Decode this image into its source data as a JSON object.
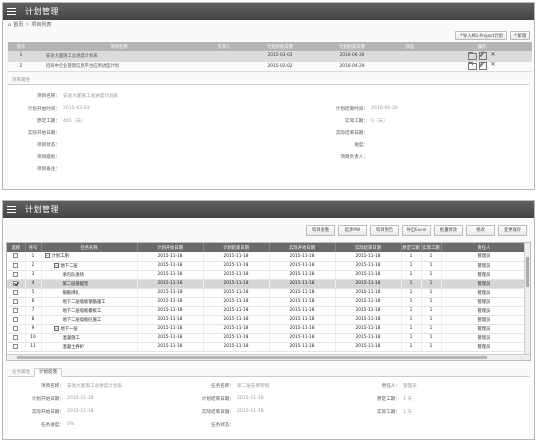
{
  "top": {
    "title": "计划管理",
    "breadcrumb": {
      "home": "首页",
      "current": "项目列表"
    },
    "buttons": {
      "import": "导入MS-Project计划",
      "add": "新增"
    },
    "columns": [
      "序号",
      "项目名称",
      "负责人",
      "计划开始日期",
      "计划结束日期",
      "状态",
      "操作"
    ],
    "rows": [
      {
        "no": "1",
        "name": "安发大厦施工总进度计划表",
        "owner": "",
        "start": "2015-03-03",
        "end": "2016-06-30",
        "status": ""
      },
      {
        "no": "2",
        "name": "招商中企业管理信息平台应用进度计划",
        "owner": "",
        "start": "2015-02-02",
        "end": "2016-04-29",
        "status": ""
      }
    ],
    "props_tab": "项目属性",
    "form": {
      "project_name_label": "项目名称：",
      "project_name": "安发大厦施工总进度计划表",
      "plan_start_label": "计划开始时间：",
      "plan_start": "2015-03-03",
      "plan_end_label": "计划结束时间：",
      "plan_end": "2016-06-30",
      "duration_label": "原定工期：",
      "duration": "465（天）",
      "actual_duration_label": "实际工期：",
      "actual_duration": "0（天）",
      "actual_start_label": "实际开始日期：",
      "actual_end_label": "实际结束日期：",
      "status_label": "项目状态：",
      "progress_label": "进度：",
      "level_label": "项目级别：",
      "owner_label": "项目负责人：",
      "note_label": "项目备注："
    }
  },
  "bottom": {
    "title": "计划管理",
    "toolbar": [
      "项目查看",
      "起步PW",
      "项目预告",
      "导出Excel",
      "批量修改",
      "修改",
      "变更保存"
    ],
    "columns": [
      "选择",
      "序号",
      "任务名称",
      "计划开始日期",
      "计划结束日期",
      "实际开始日期",
      "实际结束日期",
      "原定工期",
      "实际工期",
      "责任人"
    ],
    "rows": [
      {
        "no": "1",
        "name": "计划工期",
        "level": 0,
        "exp": "−",
        "ps": "2015-11-18",
        "pe": "2015-11-18",
        "as": "2015-11-18",
        "ae": "2015-11-18",
        "d1": "1",
        "d2": "1",
        "owner": "管理员",
        "checked": false
      },
      {
        "no": "2",
        "name": "地下二层",
        "level": 1,
        "exp": "−",
        "ps": "2015-11-18",
        "pe": "2015-11-18",
        "as": "2015-11-18",
        "ae": "2015-11-18",
        "d1": "1",
        "d2": "1",
        "owner": "管理员",
        "checked": false
      },
      {
        "no": "3",
        "name": "承包队进场",
        "level": 2,
        "exp": "",
        "ps": "2015-11-18",
        "pe": "2015-11-18",
        "as": "2015-11-18",
        "ae": "2015-11-18",
        "d1": "1",
        "d2": "1",
        "owner": "管理员",
        "checked": false
      },
      {
        "no": "4",
        "name": "第二层基础垫",
        "level": 2,
        "exp": "",
        "ps": "2015-11-18",
        "pe": "2015-11-18",
        "as": "2015-11-18",
        "ae": "2015-11-18",
        "d1": "1",
        "d2": "1",
        "owner": "管理员",
        "checked": true,
        "selected": true
      },
      {
        "no": "5",
        "name": "钢筋绑扎",
        "level": 2,
        "exp": "",
        "ps": "2015-11-18",
        "pe": "2015-11-18",
        "as": "2015-11-18",
        "ae": "2015-11-18",
        "d1": "1",
        "d2": "1",
        "owner": "管理员",
        "checked": false
      },
      {
        "no": "6",
        "name": "地下二层墙板钢筋施工",
        "level": 2,
        "exp": "",
        "ps": "2015-11-18",
        "pe": "2015-11-18",
        "as": "2015-11-18",
        "ae": "2015-11-18",
        "d1": "1",
        "d2": "1",
        "owner": "管理员",
        "checked": false
      },
      {
        "no": "7",
        "name": "地下二层墙板模板工",
        "level": 2,
        "exp": "",
        "ps": "2015-11-18",
        "pe": "2015-11-18",
        "as": "2015-11-18",
        "ae": "2015-11-18",
        "d1": "1",
        "d2": "1",
        "owner": "管理员",
        "checked": false
      },
      {
        "no": "8",
        "name": "地下二层墙板砼施工",
        "level": 2,
        "exp": "",
        "ps": "2015-11-18",
        "pe": "2015-11-18",
        "as": "2015-11-18",
        "ae": "2015-11-18",
        "d1": "1",
        "d2": "1",
        "owner": "管理员",
        "checked": false
      },
      {
        "no": "9",
        "name": "地下一层",
        "level": 1,
        "exp": "−",
        "ps": "2015-11-18",
        "pe": "2015-11-18",
        "as": "2015-11-18",
        "ae": "2015-11-18",
        "d1": "1",
        "d2": "1",
        "owner": "管理员",
        "checked": false
      },
      {
        "no": "10",
        "name": "混凝施工",
        "level": 2,
        "exp": "",
        "ps": "2015-11-18",
        "pe": "2015-11-18",
        "as": "2015-11-18",
        "ae": "2015-11-18",
        "d1": "1",
        "d2": "1",
        "owner": "管理员",
        "checked": false
      },
      {
        "no": "11",
        "name": "混凝土养护",
        "level": 2,
        "exp": "",
        "ps": "2015-11-18",
        "pe": "2015-11-18",
        "as": "2015-11-18",
        "ae": "2015-11-18",
        "d1": "1",
        "d2": "1",
        "owner": "管理员",
        "checked": false
      }
    ],
    "tabs": [
      "任务属性",
      "计划反馈"
    ],
    "form": {
      "project_name_label": "项目名称：",
      "project_name": "安发大厦施工总进度计划表",
      "task_name_label": "任务名称：",
      "task_name": "第二层支撑架钢",
      "owner_label": "责任人：",
      "owner": "管理员",
      "plan_start_label": "计划开始日期：",
      "plan_start": "2015-11-18",
      "plan_end_label": "计划结束日期：",
      "plan_end": "2015-11-18",
      "duration_label": "原定工期：",
      "duration": "1 天",
      "actual_start_label": "实际开始日期：",
      "actual_start": "2015-11-18",
      "actual_end_label": "实际结束日期：",
      "actual_end": "2015-11-18",
      "actual_duration_label": "实际工期：",
      "actual_duration": "1 天",
      "progress_label": "任务进度：",
      "progress": "0%",
      "status_label": "任务状态：",
      "status": ""
    }
  }
}
